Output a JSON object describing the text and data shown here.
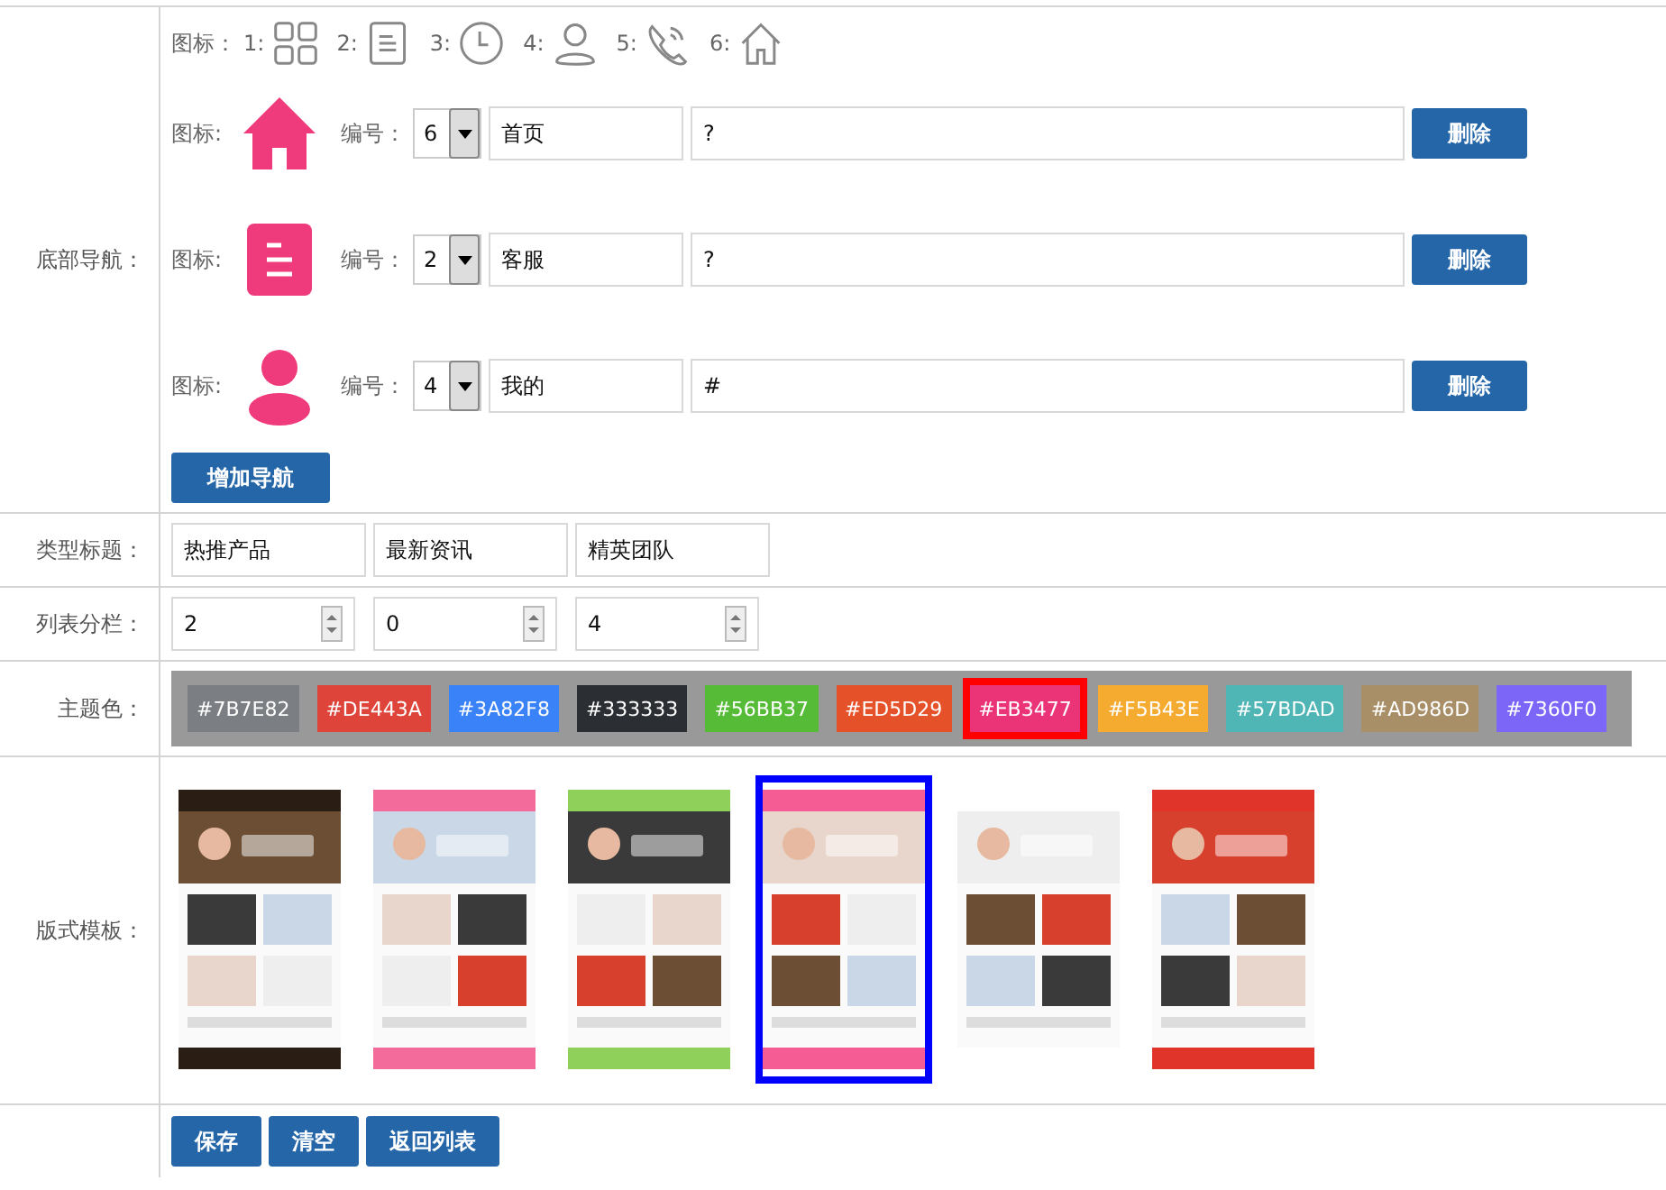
{
  "bottom_nav": {
    "label": "底部导航：",
    "legend_label": "图标：",
    "legend": [
      {
        "label": "1:",
        "kind": "grid"
      },
      {
        "label": "2:",
        "kind": "list"
      },
      {
        "label": "3:",
        "kind": "clock"
      },
      {
        "label": "4:",
        "kind": "user"
      },
      {
        "label": "5:",
        "kind": "phone"
      },
      {
        "label": "6:",
        "kind": "home"
      }
    ],
    "items": [
      {
        "icon_label": "图标:",
        "kind": "home",
        "number_label": "编号：",
        "number": "6",
        "name": "首页",
        "link": "?",
        "delete": "删除"
      },
      {
        "icon_label": "图标:",
        "kind": "list",
        "number_label": "编号：",
        "number": "2",
        "name": "客服",
        "link": "?",
        "delete": "删除"
      },
      {
        "icon_label": "图标:",
        "kind": "user",
        "number_label": "编号：",
        "number": "4",
        "name": "我的",
        "link": "#",
        "delete": "删除"
      }
    ],
    "add_button": "增加导航"
  },
  "type_titles": {
    "label": "类型标题：",
    "values": [
      "热推产品",
      "最新资讯",
      "精英团队"
    ]
  },
  "list_columns": {
    "label": "列表分栏：",
    "values": [
      "2",
      "0",
      "4"
    ]
  },
  "theme_color": {
    "label": "主题色：",
    "swatches": [
      {
        "text": "#7B7E82",
        "color": "#7b7e82",
        "selected": false
      },
      {
        "text": "#DE443A",
        "color": "#de443a",
        "selected": false
      },
      {
        "text": "#3A82F8",
        "color": "#3a82f8",
        "selected": false
      },
      {
        "text": "#333333",
        "color": "#2b2e33",
        "selected": false
      },
      {
        "text": "#56BB37",
        "color": "#56bb37",
        "selected": false
      },
      {
        "text": "#ED5D29",
        "color": "#e5522a",
        "selected": false
      },
      {
        "text": "#EB3477",
        "color": "#eb3477",
        "selected": true
      },
      {
        "text": "#F5B43E",
        "color": "#f5aa30",
        "selected": false
      },
      {
        "text": "#57BDAD",
        "color": "#50b5b5",
        "selected": false
      },
      {
        "text": "#AD986D",
        "color": "#a88f68",
        "selected": false
      },
      {
        "text": "#7360F0",
        "color": "#7b66f7",
        "selected": false
      }
    ]
  },
  "templates": {
    "label": "版式模板：",
    "items": [
      {
        "kind": "picture",
        "selected": false
      },
      {
        "kind": "picture",
        "selected": false
      },
      {
        "kind": "picture",
        "selected": false
      },
      {
        "kind": "picture",
        "selected": true
      },
      {
        "kind": "picture",
        "selected": false
      },
      {
        "kind": "picture",
        "selected": false
      }
    ]
  },
  "actions": [
    "保存",
    "清空",
    "返回列表"
  ]
}
